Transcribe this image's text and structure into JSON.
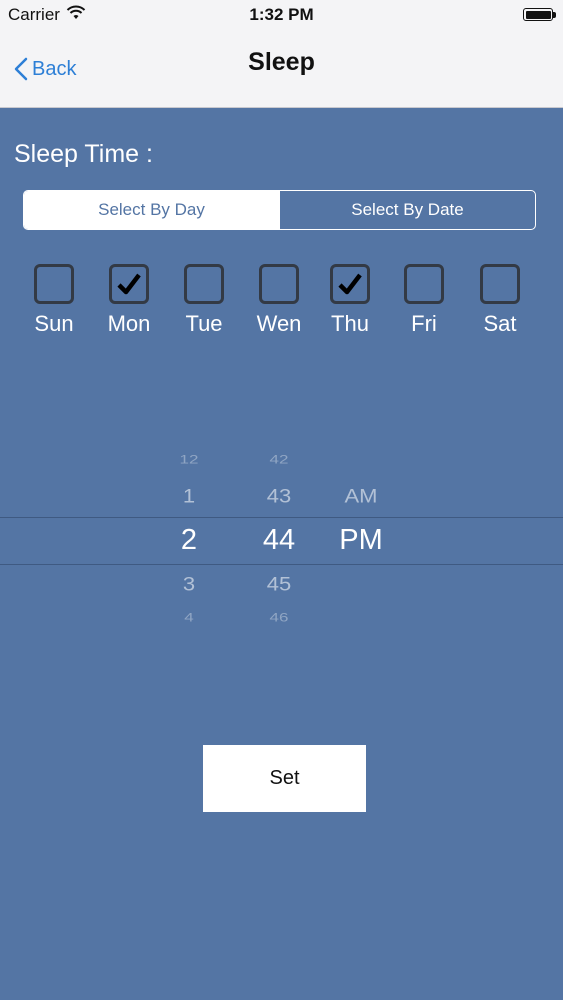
{
  "status_bar": {
    "carrier": "Carrier",
    "time": "1:32 PM"
  },
  "nav": {
    "back_label": "Back",
    "title": "Sleep"
  },
  "section_label": "Sleep Time :",
  "segments": [
    {
      "label": "Select By Day",
      "selected": true
    },
    {
      "label": "Select By Date",
      "selected": false
    }
  ],
  "days": [
    {
      "label": "Sun",
      "checked": false
    },
    {
      "label": "Mon",
      "checked": true
    },
    {
      "label": "Tue",
      "checked": false
    },
    {
      "label": "Wen",
      "checked": false
    },
    {
      "label": "Thu",
      "checked": true
    },
    {
      "label": "Fri",
      "checked": false
    },
    {
      "label": "Sat",
      "checked": false
    }
  ],
  "picker": {
    "hours": [
      "12",
      "1",
      "2",
      "3",
      "4"
    ],
    "minutes": [
      "42",
      "43",
      "44",
      "45",
      "46"
    ],
    "periods": [
      "",
      "AM",
      "PM",
      "",
      ""
    ],
    "selected": {
      "hour": "2",
      "minute": "44",
      "period": "PM"
    }
  },
  "set_button": "Set",
  "colors": {
    "background": "#5475a4",
    "nav_background": "#f4f4f6",
    "accent": "#2d7fd6",
    "checkbox_border": "#333a45"
  }
}
